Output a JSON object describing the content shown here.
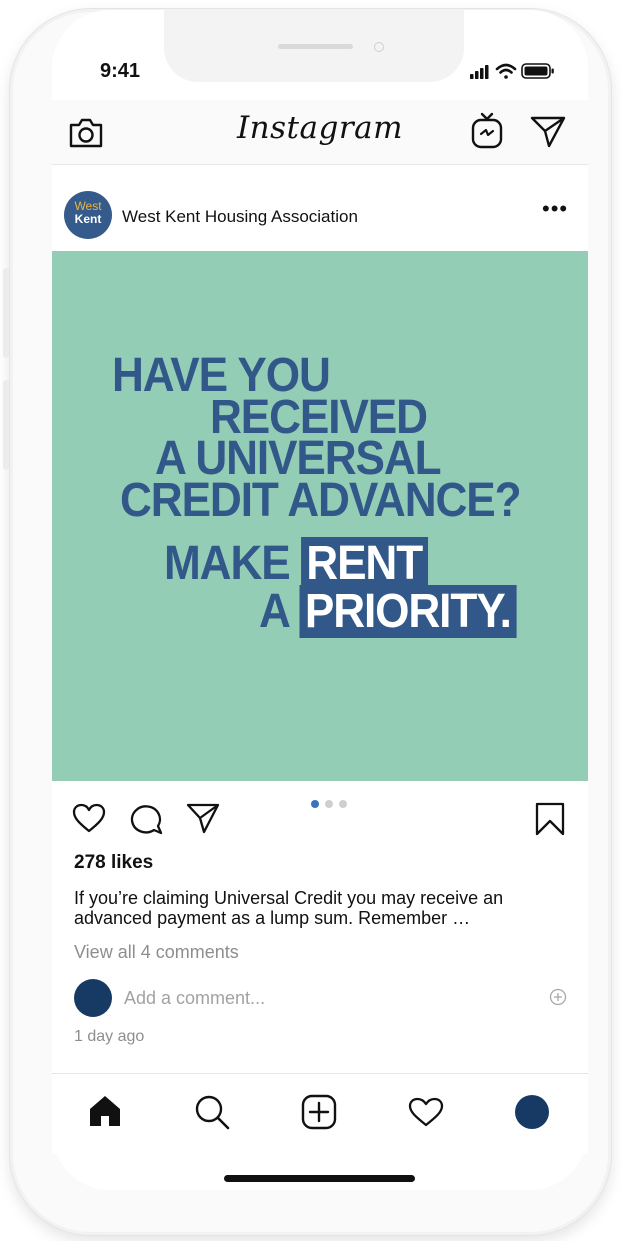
{
  "status_bar": {
    "time": "9:41"
  },
  "app": {
    "logo": "Instagram"
  },
  "post": {
    "username": "West Kent Housing Association",
    "avatar_line1": "West",
    "avatar_line2": "Kent",
    "image_text": {
      "line1": "HAVE YOU",
      "line2": "RECEIVED",
      "line3": "A UNIVERSAL",
      "line4": "CREDIT ADVANCE?",
      "line5_prefix": "MAKE",
      "line5_box": "RENT",
      "line6_prefix": "A",
      "line6_box": "PRIORITY."
    },
    "likes": "278 likes",
    "caption": "If you’re claiming Universal Credit you may receive an advanced payment as a lump sum. Remember …",
    "view_comments": "View all 4 comments",
    "comment_placeholder": "Add a comment...",
    "time_ago": "1 day ago",
    "carousel": {
      "count": 3,
      "active_index": 0
    }
  },
  "colors": {
    "image_background": "#94cdb6",
    "headline": "#325889",
    "avatar": "#355a8c",
    "accent_dot": "#3a71c1"
  },
  "icons": {
    "top_left": "camera-icon",
    "top_right": [
      "igtv-icon",
      "direct-message-icon"
    ],
    "post_actions": [
      "heart-icon",
      "comment-icon",
      "share-icon",
      "bookmark-icon"
    ],
    "bottom_nav": [
      "home-icon",
      "search-icon",
      "new-post-icon",
      "activity-heart-icon",
      "profile-avatar"
    ]
  }
}
